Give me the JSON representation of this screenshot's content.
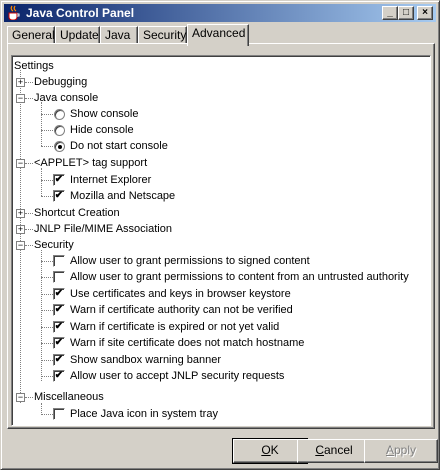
{
  "window": {
    "title": "Java Control Panel",
    "minimize": "_",
    "maximize": "□",
    "close": "×"
  },
  "tabs": [
    {
      "label": "General"
    },
    {
      "label": "Update"
    },
    {
      "label": "Java"
    },
    {
      "label": "Security"
    },
    {
      "label": "Advanced",
      "active": true
    }
  ],
  "tree": {
    "root": "Settings",
    "debugging": "Debugging",
    "java_console": "Java console",
    "show_console": "Show console",
    "hide_console": "Hide console",
    "do_not_start_console": "Do not start console",
    "applet_tag": "<APPLET> tag support",
    "internet_explorer": "Internet Explorer",
    "mozilla_netscape": "Mozilla and Netscape",
    "shortcut_creation": "Shortcut Creation",
    "jnlp_mime": "JNLP File/MIME Association",
    "security": "Security",
    "sec_items": [
      "Allow user to grant permissions to signed content",
      "Allow user to grant permissions to content from an untrusted authority",
      "Use certificates and keys in browser keystore",
      "Warn if certificate authority can not be verified",
      "Warn if certificate is expired or not yet valid",
      "Warn if site certificate does not match hostname",
      "Show sandbox warning banner",
      "Allow user to accept JNLP security requests"
    ],
    "miscellaneous": "Miscellaneous",
    "place_icon": "Place Java icon in system tray",
    "expand_plus": "+",
    "expand_minus": "−",
    "check_mark": "✔"
  },
  "buttons": {
    "ok": "OK",
    "ok_mnemonic": "O",
    "ok_rest": "K",
    "cancel": "Cancel",
    "cancel_mnemonic": "C",
    "cancel_rest": "ancel",
    "apply": "Apply",
    "apply_mnemonic": "A",
    "apply_rest": "pply"
  }
}
